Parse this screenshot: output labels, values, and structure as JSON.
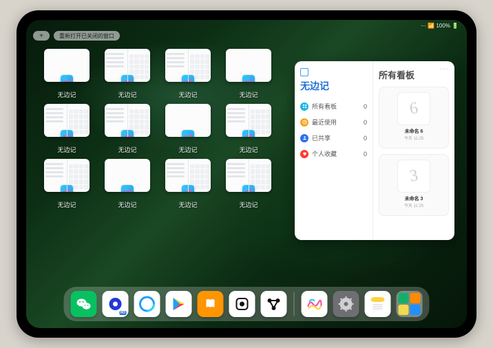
{
  "statusbar": {
    "time": "",
    "right": "⋯ 📶 100% 🔋"
  },
  "topbar": {
    "plus": "+",
    "reopen_label": "重新打开已关闭的窗口"
  },
  "thumbs": [
    {
      "label": "无边记",
      "variant": "blank"
    },
    {
      "label": "无边记",
      "variant": "split"
    },
    {
      "label": "无边记",
      "variant": "split"
    },
    {
      "label": "无边记",
      "variant": "blank"
    },
    {
      "label": "无边记",
      "variant": "split"
    },
    {
      "label": "无边记",
      "variant": "split"
    },
    {
      "label": "无边记",
      "variant": "blank"
    },
    {
      "label": "无边记",
      "variant": "split"
    },
    {
      "label": "无边记",
      "variant": "split"
    },
    {
      "label": "无边记",
      "variant": "blank"
    },
    {
      "label": "无边记",
      "variant": "split"
    },
    {
      "label": "无边记",
      "variant": "split"
    }
  ],
  "window": {
    "app_title": "无边记",
    "right_title": "所有看板",
    "more": "···",
    "sidebar": [
      {
        "label": "所有看板",
        "count": "0",
        "color": "#19b7e6",
        "icon": "grid"
      },
      {
        "label": "最近使用",
        "count": "0",
        "color": "#f4a523",
        "icon": "clock"
      },
      {
        "label": "已共享",
        "count": "0",
        "color": "#2d6ff0",
        "icon": "person"
      },
      {
        "label": "个人收藏",
        "count": "0",
        "color": "#ff3b30",
        "icon": "heart"
      }
    ],
    "boards": [
      {
        "glyph": "6",
        "name": "未命名 6",
        "sub": "今天 11:25"
      },
      {
        "glyph": "3",
        "name": "未命名 3",
        "sub": "今天 11:25"
      }
    ]
  },
  "dock": {
    "apps": [
      {
        "name": "wechat",
        "bg": "#07c160"
      },
      {
        "name": "quark",
        "bg": "#ffffff"
      },
      {
        "name": "qqbrowser",
        "bg": "#ffffff"
      },
      {
        "name": "play",
        "bg": "#ffffff"
      },
      {
        "name": "books",
        "bg": "#ff9500"
      },
      {
        "name": "dice",
        "bg": "#ffffff"
      },
      {
        "name": "nodes",
        "bg": "#ffffff"
      }
    ],
    "recent": [
      {
        "name": "freeform",
        "bg": "#ffffff"
      },
      {
        "name": "settings",
        "bg": "#6e6e73"
      },
      {
        "name": "notes",
        "bg": "#ffffff"
      }
    ],
    "tray": [
      "#11b06a",
      "#ff8a00",
      "#f2d94e",
      "#1e90ff"
    ]
  }
}
